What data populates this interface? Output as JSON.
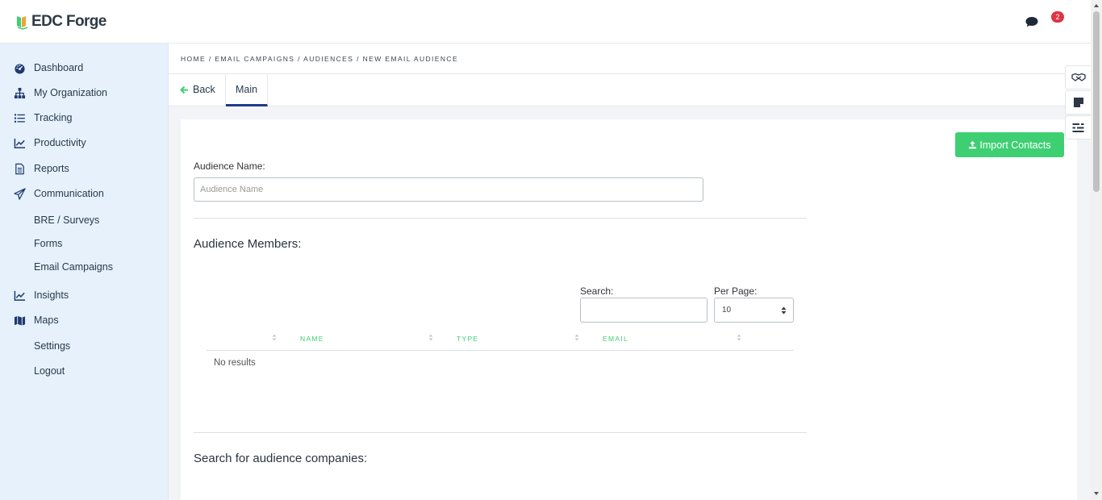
{
  "app": {
    "brand": "EDC Forge",
    "notification_count": "2"
  },
  "sidebar": {
    "items": [
      {
        "label": "Dashboard",
        "icon": "dashboard-icon"
      },
      {
        "label": "My Organization",
        "icon": "org-chart-icon"
      },
      {
        "label": "Tracking",
        "icon": "list-icon"
      },
      {
        "label": "Productivity",
        "icon": "line-chart-icon"
      },
      {
        "label": "Reports",
        "icon": "document-icon"
      },
      {
        "label": "Communication",
        "icon": "paper-plane-icon"
      },
      {
        "label": "BRE / Surveys"
      },
      {
        "label": "Forms"
      },
      {
        "label": "Email Campaigns"
      },
      {
        "label": "Insights",
        "icon": "line-chart-icon"
      },
      {
        "label": "Maps",
        "icon": "map-icon"
      },
      {
        "label": "Settings"
      },
      {
        "label": "Logout"
      }
    ]
  },
  "breadcrumb": "HOME / EMAIL CAMPAIGNS / AUDIENCES / NEW EMAIL AUDIENCE",
  "tabs": {
    "back": "Back",
    "main": "Main"
  },
  "form": {
    "import_button": "Import Contacts",
    "audience_name_label": "Audience Name:",
    "audience_name_placeholder": "Audience Name",
    "audience_name_value": "",
    "members_title": "Audience Members:",
    "search_label": "Search:",
    "search_value": "",
    "per_page_label": "Per Page:",
    "per_page_value": "10",
    "columns": [
      "",
      "NAME",
      "TYPE",
      "EMAIL"
    ],
    "empty_message": "No results",
    "companies_title": "Search for audience companies:"
  },
  "colors": {
    "accent_green": "#3ecf73",
    "sidebar_bg": "#e6f1fb",
    "tab_active": "#1e3a8a",
    "badge_red": "#dc3545"
  }
}
